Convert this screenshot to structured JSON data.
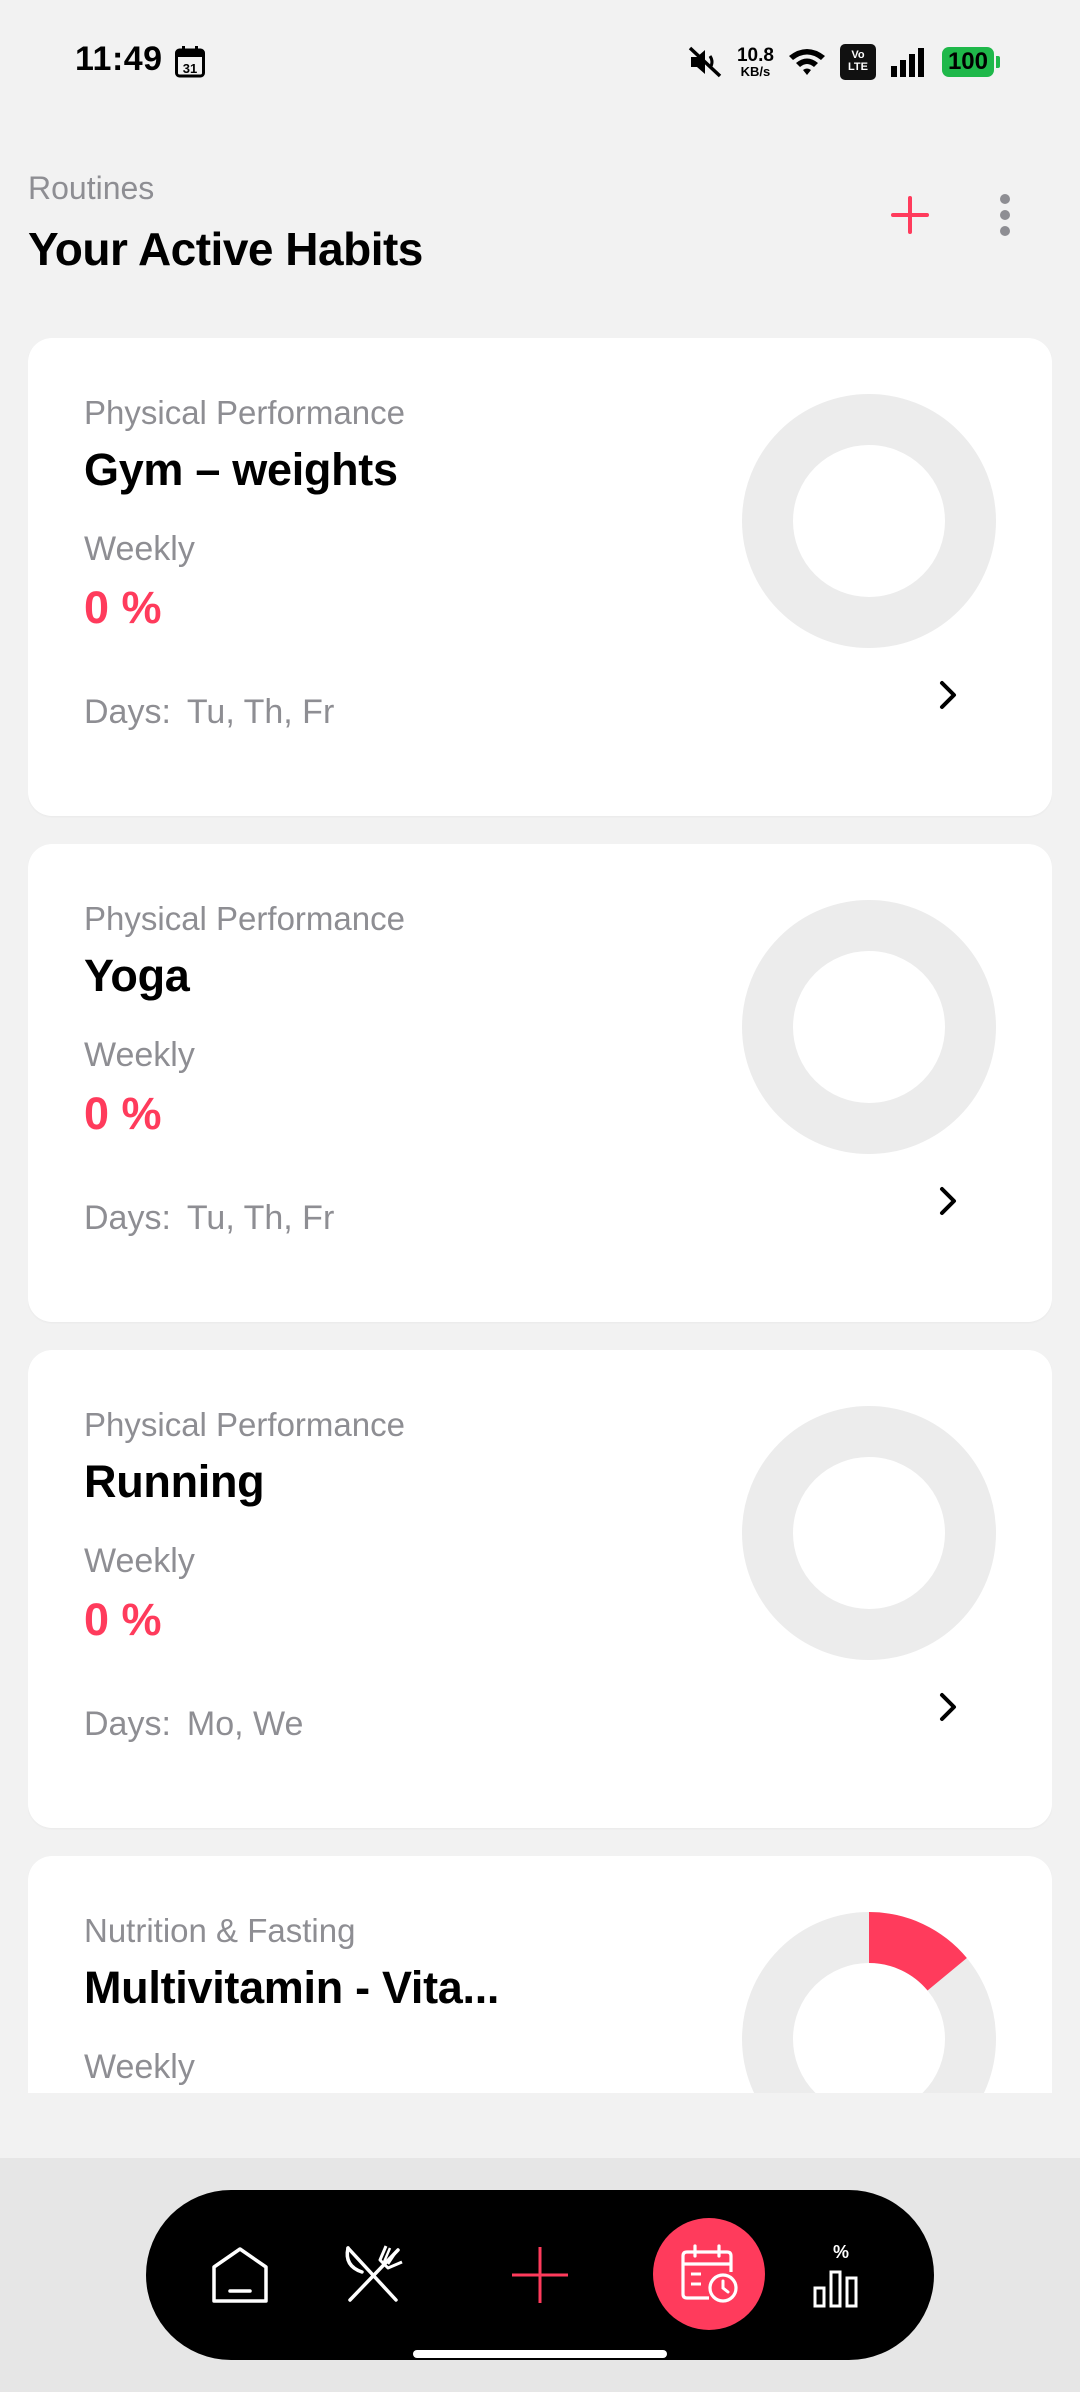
{
  "status_bar": {
    "time": "11:49",
    "calendar_day": "31",
    "net_speed_value": "10.8",
    "net_speed_unit": "KB/s",
    "volte_top": "Vo",
    "volte_bottom": "LTE",
    "battery": "100"
  },
  "header": {
    "subtitle": "Routines",
    "title": "Your Active Habits"
  },
  "colors": {
    "accent": "#ff3b5c",
    "ring_track": "#ececec",
    "muted_text": "#8e8e93"
  },
  "labels": {
    "days_prefix": "Days:"
  },
  "habits": [
    {
      "category": "Physical Performance",
      "name": "Gym – weights",
      "frequency": "Weekly",
      "percent": "0 %",
      "progress": 0,
      "days": "Tu, Th, Fr"
    },
    {
      "category": "Physical Performance",
      "name": "Yoga",
      "frequency": "Weekly",
      "percent": "0 %",
      "progress": 0,
      "days": "Tu, Th, Fr"
    },
    {
      "category": "Physical Performance",
      "name": "Running",
      "frequency": "Weekly",
      "percent": "0 %",
      "progress": 0,
      "days": "Mo, We"
    },
    {
      "category": "Nutrition & Fasting",
      "name": "Multivitamin - Vita...",
      "frequency": "Weekly",
      "percent": "",
      "progress": 0.14,
      "days": ""
    }
  ],
  "nav": {
    "items": [
      {
        "name": "nav-home",
        "icon": "home-icon",
        "active": false
      },
      {
        "name": "nav-nutrition",
        "icon": "fork-knife-icon",
        "active": false
      },
      {
        "name": "nav-add",
        "icon": "plus-icon",
        "active": false
      },
      {
        "name": "nav-habits",
        "icon": "calendar-clock-icon",
        "active": true
      },
      {
        "name": "nav-stats",
        "icon": "bar-chart-percent-icon",
        "active": false
      }
    ]
  }
}
